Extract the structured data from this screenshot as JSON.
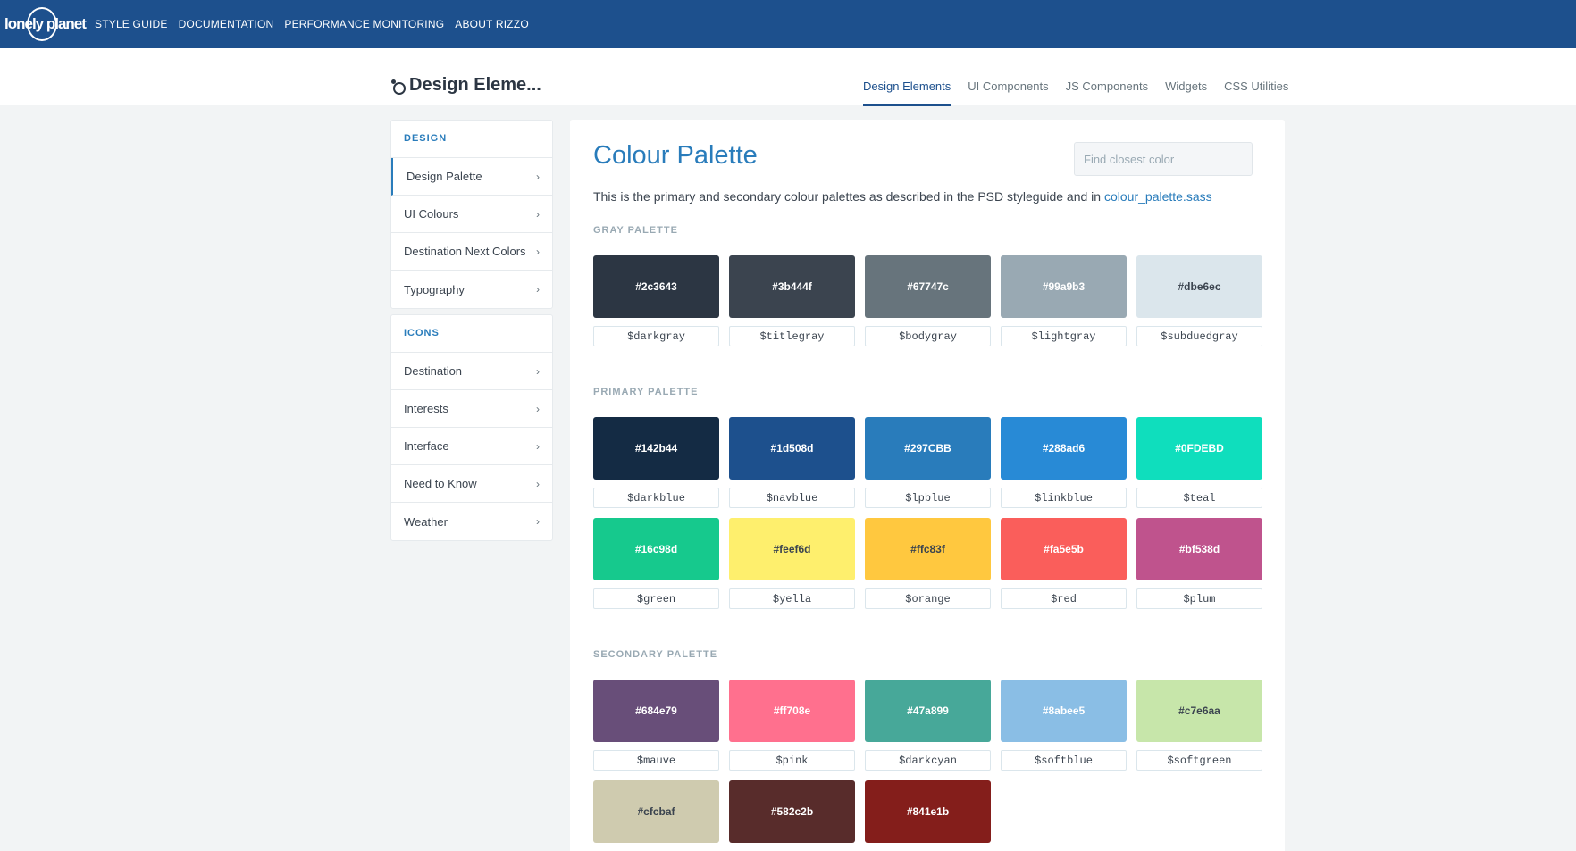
{
  "topbar": {
    "logo_text": "lonely planet",
    "nav": [
      "STYLE GUIDE",
      "DOCUMENTATION",
      "PERFORMANCE MONITORING",
      "ABOUT RIZZO"
    ]
  },
  "header": {
    "title": "Design Eleme...",
    "tabs": [
      "Design Elements",
      "UI Components",
      "JS Components",
      "Widgets",
      "CSS Utilities"
    ],
    "active_tab": "Design Elements"
  },
  "sidebar": {
    "design": {
      "heading": "DESIGN",
      "items": [
        "Design Palette",
        "UI Colours",
        "Destination Next Colors",
        "Typography"
      ]
    },
    "icons": {
      "heading": "ICONS",
      "items": [
        "Destination",
        "Interests",
        "Interface",
        "Need to Know",
        "Weather"
      ]
    }
  },
  "main": {
    "title": "Colour Palette",
    "search_placeholder": "Find closest color",
    "intro_text": "This is the primary and secondary colour palettes as described in the PSD styleguide and in ",
    "intro_link": "colour_palette.sass",
    "gray": {
      "heading": "GRAY PALETTE",
      "swatches": [
        {
          "hex": "#2c3643",
          "var": "$darkgray",
          "text_color": "#ffffff"
        },
        {
          "hex": "#3b444f",
          "var": "$titlegray",
          "text_color": "#ffffff"
        },
        {
          "hex": "#67747c",
          "var": "$bodygray",
          "text_color": "#ffffff"
        },
        {
          "hex": "#99a9b3",
          "var": "$lightgray",
          "text_color": "#ffffff"
        },
        {
          "hex": "#dbe6ec",
          "var": "$subduedgray",
          "text_color": "#3b444f"
        }
      ]
    },
    "primary": {
      "heading": "PRIMARY PALETTE",
      "swatches": [
        {
          "hex": "#142b44",
          "var": "$darkblue",
          "text_color": "#ffffff"
        },
        {
          "hex": "#1d508d",
          "var": "$navblue",
          "text_color": "#ffffff"
        },
        {
          "hex": "#297CBB",
          "var": "$lpblue",
          "text_color": "#ffffff"
        },
        {
          "hex": "#288ad6",
          "var": "$linkblue",
          "text_color": "#ffffff"
        },
        {
          "hex": "#0FDEBD",
          "var": "$teal",
          "text_color": "#ffffff"
        },
        {
          "hex": "#16c98d",
          "var": "$green",
          "text_color": "#ffffff"
        },
        {
          "hex": "#feef6d",
          "var": "$yella",
          "text_color": "#3b444f"
        },
        {
          "hex": "#ffc83f",
          "var": "$orange",
          "text_color": "#3b444f"
        },
        {
          "hex": "#fa5e5b",
          "var": "$red",
          "text_color": "#ffffff"
        },
        {
          "hex": "#bf538d",
          "var": "$plum",
          "text_color": "#ffffff"
        }
      ]
    },
    "secondary": {
      "heading": "SECONDARY PALETTE",
      "swatches": [
        {
          "hex": "#684e79",
          "var": "$mauve",
          "text_color": "#ffffff"
        },
        {
          "hex": "#ff708e",
          "var": "$pink",
          "text_color": "#ffffff"
        },
        {
          "hex": "#47a899",
          "var": "$darkcyan",
          "text_color": "#ffffff"
        },
        {
          "hex": "#8abee5",
          "var": "$softblue",
          "text_color": "#ffffff"
        },
        {
          "hex": "#c7e6aa",
          "var": "$softgreen",
          "text_color": "#3b444f"
        },
        {
          "hex": "#cfcbaf",
          "var": "",
          "text_color": "#3b444f"
        },
        {
          "hex": "#582c2b",
          "var": "",
          "text_color": "#ffffff"
        },
        {
          "hex": "#841e1b",
          "var": "",
          "text_color": "#ffffff"
        }
      ]
    }
  }
}
